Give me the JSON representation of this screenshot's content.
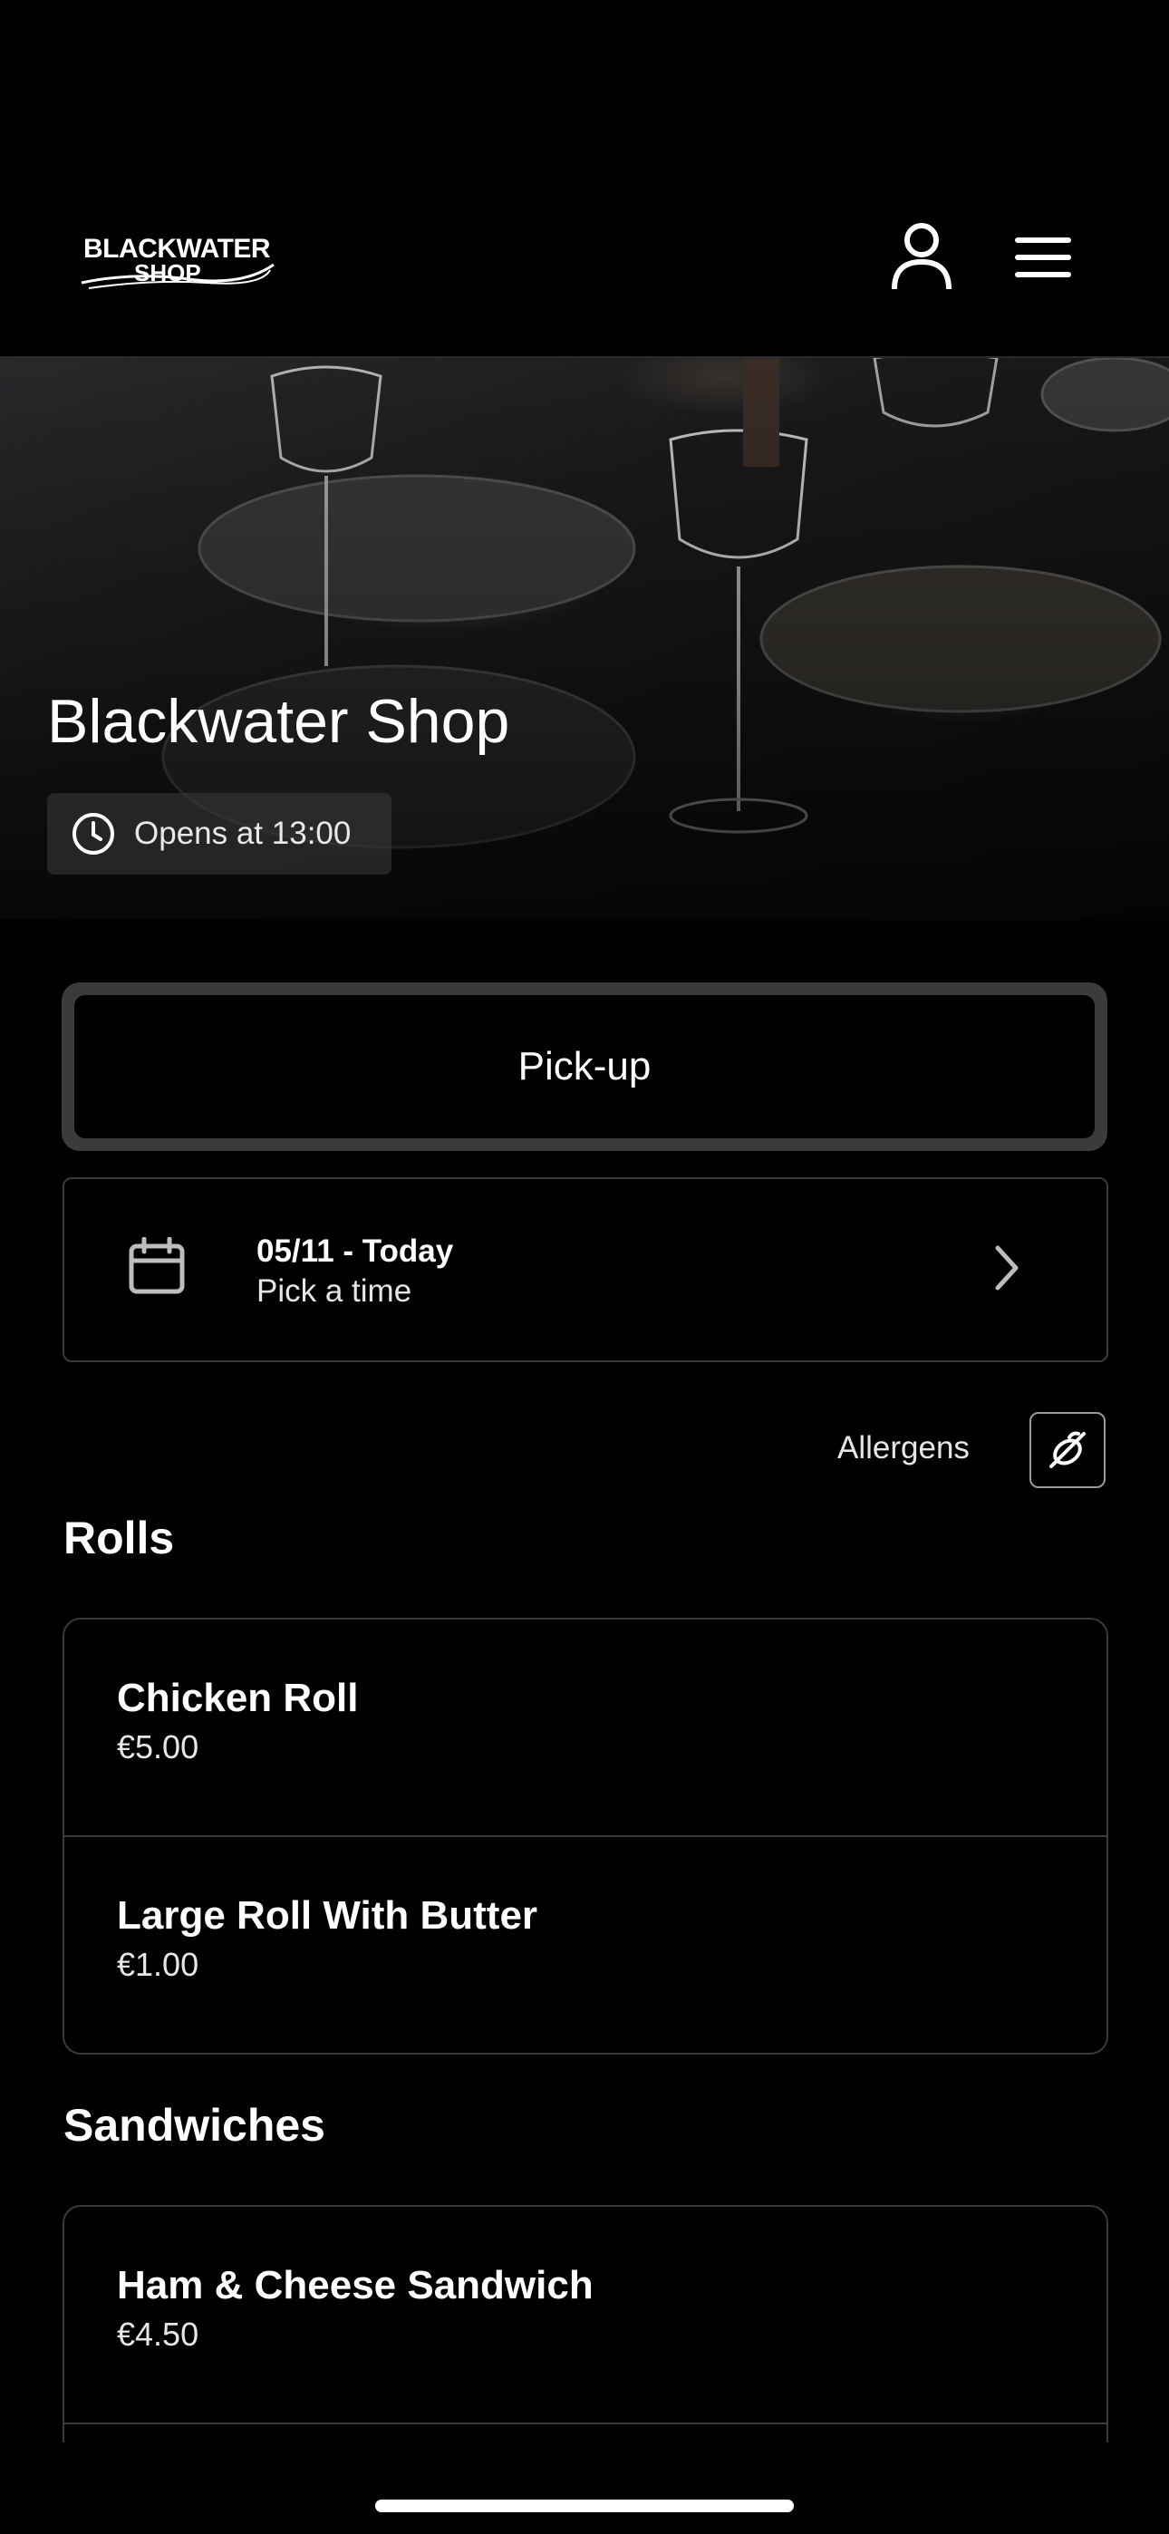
{
  "header": {
    "logo_line1": "BLACKWATER",
    "logo_line2": "SHOP",
    "account_icon": "user-icon",
    "menu_icon": "hamburger-menu-icon"
  },
  "hero": {
    "title": "Blackwater Shop",
    "opening_status": "Opens at 13:00",
    "clock_icon": "clock-icon"
  },
  "order_type": {
    "label": "Pick-up"
  },
  "schedule": {
    "date_label": "05/11 - Today",
    "time_label": "Pick a time",
    "calendar_icon": "calendar-icon",
    "chevron_icon": "chevron-right-icon"
  },
  "allergens": {
    "label": "Allergens",
    "icon": "allergen-filter-icon"
  },
  "menu": {
    "sections": [
      {
        "title": "Rolls",
        "items": [
          {
            "name": "Chicken Roll",
            "price": "€5.00"
          },
          {
            "name": "Large Roll With Butter",
            "price": "€1.00"
          }
        ]
      },
      {
        "title": "Sandwiches",
        "items": [
          {
            "name": "Ham & Cheese Sandwich",
            "price": "€4.50"
          }
        ]
      }
    ]
  },
  "colors": {
    "background": "#000000",
    "text": "#ffffff",
    "border": "#3a3a3a",
    "pickup_frame": "#3b3b3b"
  }
}
